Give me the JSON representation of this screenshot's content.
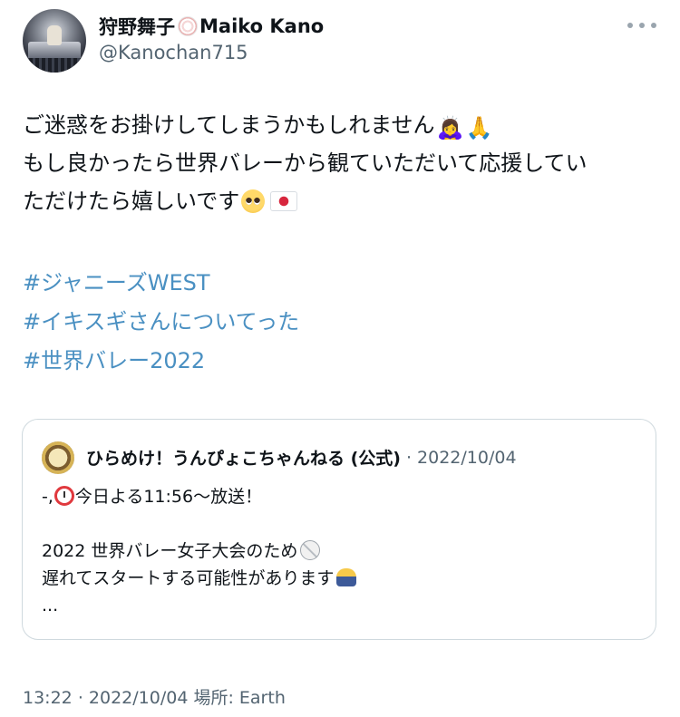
{
  "author": {
    "name_jp": "狩野舞子",
    "name_emoji": "fish-cake-icon",
    "name_en": "Maiko Kano",
    "handle": "@Kanochan715"
  },
  "tweet": {
    "lines": [
      "ご迷惑をお掛けしてしまうかもしれません",
      "もし良かったら世界バレーから観ていただいて応援してい",
      "ただけたら嬉しいです"
    ],
    "line1_emojis": [
      "🙇‍♀️",
      "🙏"
    ],
    "hashtags": [
      "#ジャニーズWEST",
      "#イキスギさんについてった",
      "#世界バレー2022"
    ]
  },
  "quoted": {
    "name": "ひらめけ！うんぴょこちゃんねる (公式)",
    "separator": "·",
    "date": "2022/10/04",
    "line1_prefix": "-,",
    "line1_text": "今日よる11:56〜放送！",
    "line2": "2022 世界バレー女子大会のため",
    "line3": "遅れてスタートする可能性があります",
    "line4": "..."
  },
  "footer": {
    "time": "13:22",
    "separator": "·",
    "date": "2022/10/04",
    "location": "場所: Earth"
  },
  "colors": {
    "link": "#4a90c2",
    "muted": "#536471",
    "text": "#0f1419",
    "border": "#cfd9de"
  }
}
